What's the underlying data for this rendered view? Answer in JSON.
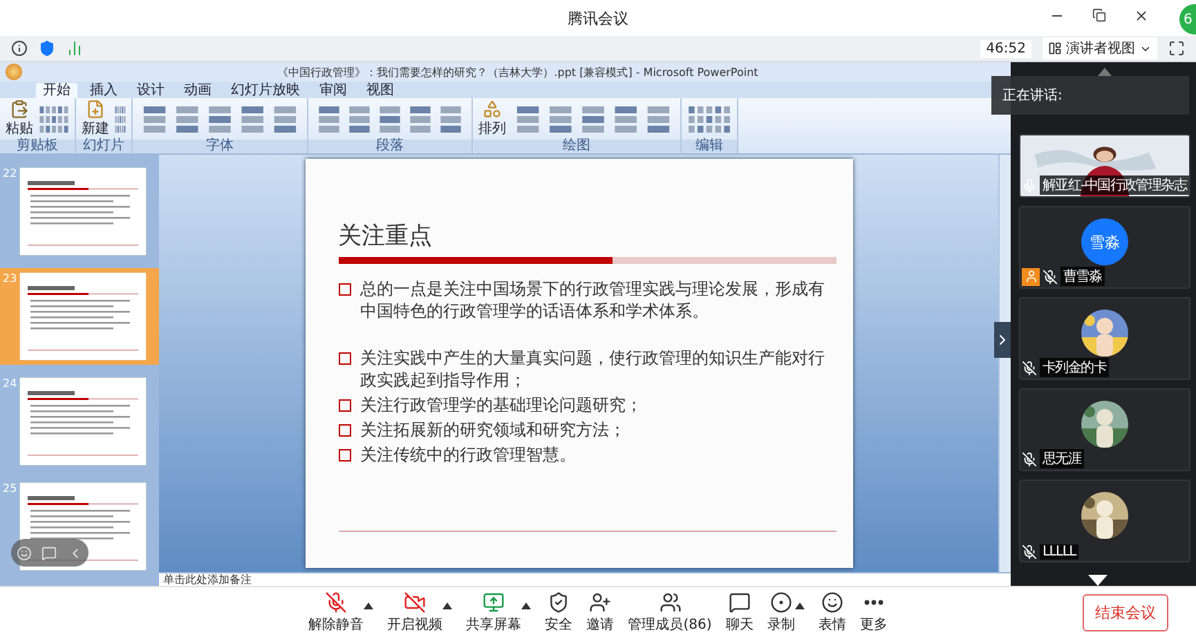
{
  "app_title": "腾讯会议",
  "status": {
    "timer": "46:52",
    "view_button": "演讲者视图",
    "badge": "6"
  },
  "ppt": {
    "title": "《中国行政管理》：我们需要怎样的研究？（吉林大学）.ppt [兼容模式] - Microsoft PowerPoint",
    "tabs": [
      {
        "label": "开始",
        "selected": true
      },
      {
        "label": "插入",
        "selected": false
      },
      {
        "label": "设计",
        "selected": false
      },
      {
        "label": "动画",
        "selected": false
      },
      {
        "label": "幻灯片放映",
        "selected": false
      },
      {
        "label": "审阅",
        "selected": false
      },
      {
        "label": "视图",
        "selected": false
      }
    ],
    "groups": [
      {
        "label": "剪贴板",
        "button": "粘贴"
      },
      {
        "label": "幻灯片",
        "button": "新建"
      },
      {
        "label": "字体"
      },
      {
        "label": "段落"
      },
      {
        "label": "绘图",
        "button": "排列"
      },
      {
        "label": "编辑"
      }
    ],
    "thumbnails": [
      {
        "number": "22",
        "selected": false
      },
      {
        "number": "23",
        "selected": true
      },
      {
        "number": "24",
        "selected": false
      },
      {
        "number": "25",
        "selected": false
      }
    ],
    "slide": {
      "title": "关注重点",
      "paragraph_groups": [
        [
          "总的一点是关注中国场景下的行政管理实践与理论发展，形成有中国特色的行政管理学的话语体系和学术体系。"
        ],
        [
          "关注实践中产生的大量真实问题，使行政管理的知识生产能对行政实践起到指导作用；",
          "关注行政管理学的基础理论问题研究；",
          "关注拓展新的研究领域和研究方法；",
          "关注传统中的行政管理智慧。"
        ]
      ]
    },
    "notes_placeholder": "单击此处添加备注"
  },
  "speaking_label": "正在讲话:",
  "participants": [
    {
      "name": "解亚红-中国行政管理杂志",
      "kind": "video",
      "muted": false,
      "host": false
    },
    {
      "name": "曹雪淼",
      "kind": "initials",
      "avatar_text": "雪淼",
      "muted": true,
      "host": true
    },
    {
      "name": "卡列金的卡",
      "muted": true,
      "host": false
    },
    {
      "name": "思无涯",
      "muted": true,
      "host": false
    },
    {
      "name": "LLLLL",
      "muted": true,
      "host": false
    }
  ],
  "toolbar": [
    {
      "label": "解除静音",
      "kind": "mic-off",
      "caret": true
    },
    {
      "label": "开启视频",
      "kind": "video-off",
      "caret": true
    },
    {
      "label": "共享屏幕",
      "kind": "share",
      "caret": true
    },
    {
      "label": "安全",
      "kind": "security",
      "caret": false
    },
    {
      "label": "邀请",
      "kind": "invite",
      "caret": false
    },
    {
      "label": "管理成员(86)",
      "kind": "members",
      "caret": false
    },
    {
      "label": "聊天",
      "kind": "chat",
      "caret": false
    },
    {
      "label": "录制",
      "kind": "record",
      "caret": true
    },
    {
      "label": "表情",
      "kind": "emoji",
      "caret": false
    },
    {
      "label": "更多",
      "kind": "more",
      "caret": false
    }
  ],
  "end_button": "结束会议"
}
